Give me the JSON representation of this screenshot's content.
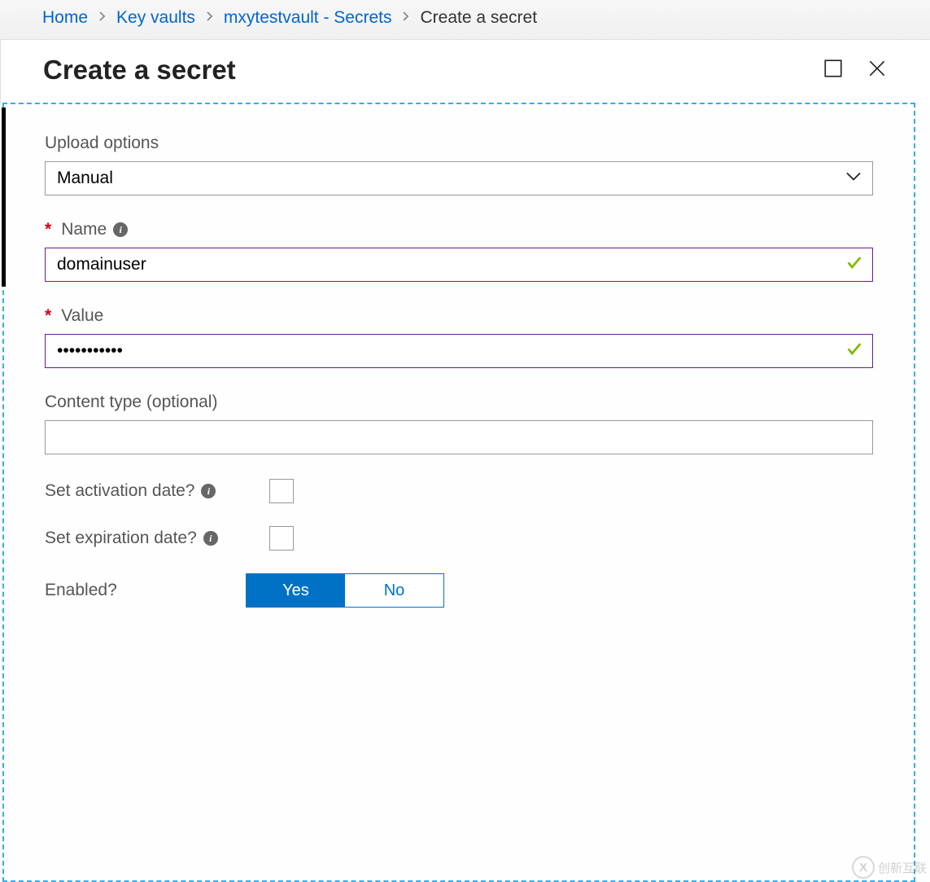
{
  "breadcrumb": {
    "home": "Home",
    "keyvaults": "Key vaults",
    "vault": "mxytestvault - Secrets",
    "current": "Create a secret"
  },
  "header": {
    "title": "Create a secret"
  },
  "form": {
    "upload_options": {
      "label": "Upload options",
      "value": "Manual"
    },
    "name": {
      "label": "Name",
      "value": "domainuser",
      "required": true
    },
    "value": {
      "label": "Value",
      "value": "•••••••••••",
      "required": true
    },
    "content_type": {
      "label": "Content type (optional)",
      "value": ""
    },
    "activation_date": {
      "label": "Set activation date?"
    },
    "expiration_date": {
      "label": "Set expiration date?"
    },
    "enabled": {
      "label": "Enabled?",
      "yes": "Yes",
      "no": "No"
    }
  },
  "watermark": {
    "text": "创新互联"
  }
}
